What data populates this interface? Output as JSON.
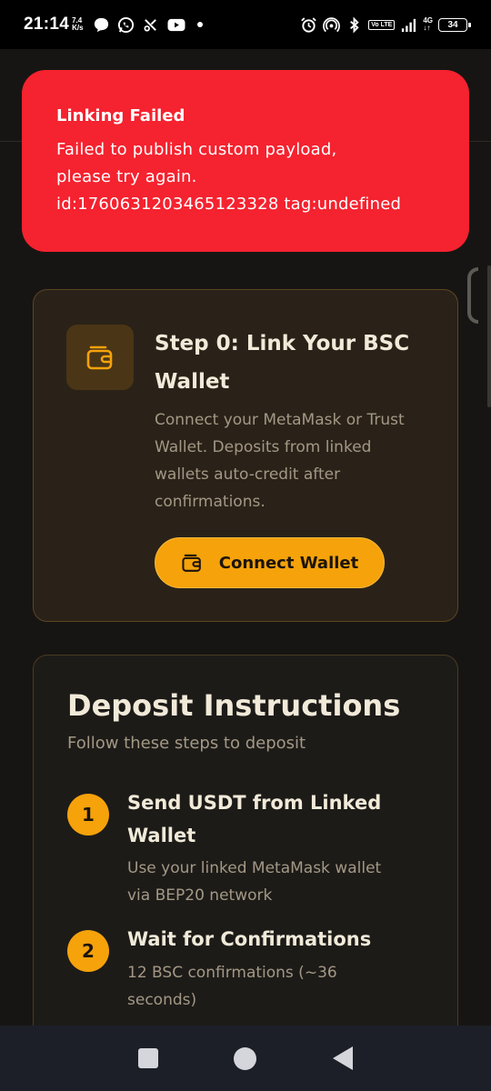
{
  "status_bar": {
    "time": "21:14",
    "net_speed_value": "7.4",
    "net_speed_unit": "K/s",
    "volte": "Vo LTE",
    "network_top": "4G",
    "network_bottom": "↓↑",
    "battery": "34"
  },
  "toast": {
    "title": "Linking Failed",
    "line1": "Failed to publish custom payload,",
    "line2": "please try again.",
    "line3": "id:1760631203465123328 tag:undefined"
  },
  "link_card": {
    "title": "Step 0: Link Your BSC Wallet",
    "description": "Connect your MetaMask or Trust Wallet. Deposits from linked wallets auto-credit after confirmations.",
    "button_label": "Connect Wallet"
  },
  "deposit": {
    "title": "Deposit Instructions",
    "subtitle": "Follow these steps to deposit",
    "steps": [
      {
        "number": "1",
        "title": "Send USDT from Linked Wallet",
        "description": "Use your linked MetaMask wallet via BEP20 network"
      },
      {
        "number": "2",
        "title": "Wait for Confirmations",
        "description": "12 BSC confirmations (~36 seconds)"
      }
    ]
  },
  "colors": {
    "accent": "#f5a20b",
    "error": "#f5222f",
    "background": "#171513"
  },
  "icons": [
    "chat-bubble-icon",
    "whatsapp-icon",
    "missed-call-icon",
    "youtube-icon",
    "alarm-icon",
    "hotspot-icon",
    "bluetooth-icon",
    "signal-icon",
    "wallet-icon",
    "square-nav-icon",
    "home-nav-icon",
    "back-nav-icon"
  ]
}
